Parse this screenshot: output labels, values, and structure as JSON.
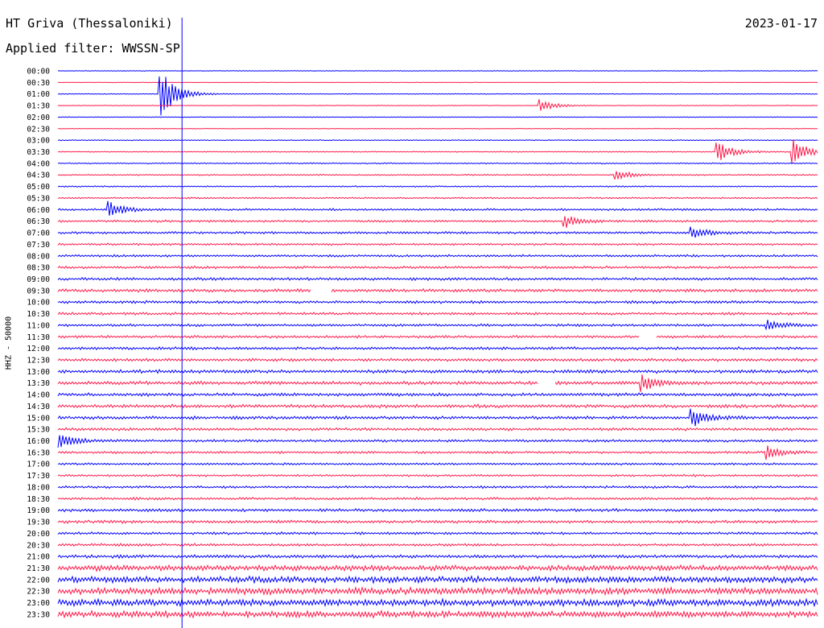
{
  "header": {
    "station": "HT Griva (Thessaloniki)",
    "filter": "Applied filter: WWSSN-SP",
    "date": "2023-01-17"
  },
  "axis_label": "HHZ - 50000",
  "colors": {
    "even_trace": "#0000ff",
    "odd_trace": "#ff1a4b",
    "background": "#ffffff"
  },
  "chart_data": {
    "type": "line",
    "title": "HT Griva (Thessaloniki)",
    "subtitle": "Applied filter: WWSSN-SP",
    "date": "2023-01-17",
    "ylabel": "HHZ - 50000",
    "row_labels": [
      "00:00",
      "00:30",
      "01:00",
      "01:30",
      "02:00",
      "02:30",
      "03:00",
      "03:30",
      "04:00",
      "04:30",
      "05:00",
      "05:30",
      "06:00",
      "06:30",
      "07:00",
      "07:30",
      "08:00",
      "08:30",
      "09:00",
      "09:30",
      "10:00",
      "10:30",
      "11:00",
      "11:30",
      "12:00",
      "12:30",
      "13:00",
      "13:30",
      "14:00",
      "14:30",
      "15:00",
      "15:30",
      "16:00",
      "16:30",
      "17:00",
      "17:30",
      "18:00",
      "18:30",
      "19:00",
      "19:30",
      "20:00",
      "20:30",
      "21:00",
      "21:30",
      "22:00",
      "22:30",
      "23:00",
      "23:30"
    ],
    "row_minutes": 30,
    "trace_colors": [
      "#0000ff",
      "#ff1a4b"
    ],
    "noise_levels": [
      0.3,
      0.3,
      0.35,
      0.35,
      0.35,
      0.4,
      0.45,
      0.5,
      0.6,
      0.6,
      0.6,
      0.7,
      1.0,
      1.1,
      1.1,
      1.0,
      1.1,
      1.2,
      1.3,
      1.5,
      1.3,
      1.2,
      1.2,
      1.2,
      1.3,
      1.4,
      1.6,
      1.7,
      1.5,
      1.6,
      1.5,
      1.3,
      1.2,
      1.1,
      1.0,
      1.0,
      1.1,
      1.2,
      1.4,
      1.4,
      1.2,
      1.2,
      1.5,
      2.6,
      3.0,
      3.2,
      3.2,
      3.0
    ],
    "events": [
      {
        "time": "01:04",
        "amplitude": 34
      },
      {
        "time": "01:49",
        "amplitude": 8
      },
      {
        "time": "03:56",
        "amplitude": 14
      },
      {
        "time": "03:59",
        "amplitude": 16
      },
      {
        "time": "04:52",
        "amplitude": 7
      },
      {
        "time": "06:02",
        "amplitude": 10
      },
      {
        "time": "06:50",
        "amplitude": 8
      },
      {
        "time": "07:25",
        "amplitude": 7
      },
      {
        "time": "11:28",
        "amplitude": 6
      },
      {
        "time": "13:53",
        "amplitude": 11
      },
      {
        "time": "15:25",
        "amplitude": 12
      },
      {
        "time": "16:00",
        "amplitude": 10
      },
      {
        "time": "16:58",
        "amplitude": 8
      }
    ],
    "gaps": [
      {
        "time": "09:40",
        "duration_min": 0.8
      },
      {
        "time": "11:53",
        "duration_min": 0.6
      },
      {
        "time": "13:49",
        "duration_min": 0.6
      }
    ],
    "marker": {
      "minute": 4.9
    }
  }
}
